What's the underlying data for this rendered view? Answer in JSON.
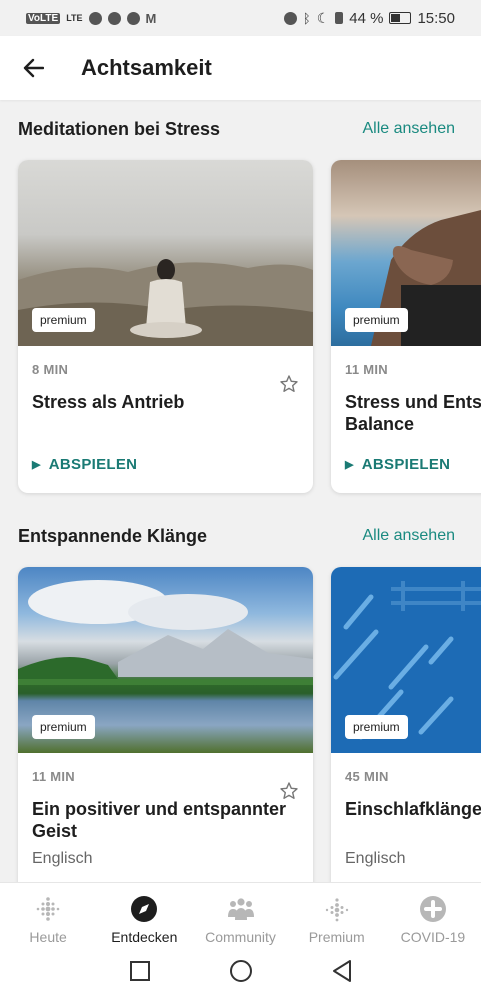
{
  "status_bar": {
    "left_icons": [
      "volte-icon",
      "lte-signal-icon",
      "eye-icon",
      "spotify-icon",
      "line-icon",
      "gmail-icon"
    ],
    "left_text": {
      "volte": "VoLTE",
      "lte": "LTE"
    },
    "battery_percent": "44 %",
    "battery_level": 0.44,
    "time": "15:50"
  },
  "app_bar": {
    "title": "Achtsamkeit"
  },
  "sections": [
    {
      "title": "Meditationen bei Stress",
      "see_all": "Alle ansehen",
      "cards": [
        {
          "badge": "premium",
          "duration": "8 MIN",
          "title": "Stress als Antrieb",
          "action": "ABSPIELEN"
        },
        {
          "badge": "premium",
          "duration": "11 MIN",
          "title": "Stress und Entspannung in Balance",
          "action": "ABSPIELEN"
        }
      ]
    },
    {
      "title": "Entspannende Klänge",
      "see_all": "Alle ansehen",
      "cards": [
        {
          "badge": "premium",
          "duration": "11 MIN",
          "title": "Ein positiver und entspannter Geist",
          "subtitle": "Englisch"
        },
        {
          "badge": "premium",
          "duration": "45 MIN",
          "title": "Einschlafklänge und",
          "subtitle": "Englisch"
        }
      ]
    }
  ],
  "bottom_nav": [
    {
      "label": "Heute",
      "icon": "dots-icon",
      "active": false
    },
    {
      "label": "Entdecken",
      "icon": "compass-icon",
      "active": true
    },
    {
      "label": "Community",
      "icon": "community-icon",
      "active": false
    },
    {
      "label": "Premium",
      "icon": "dots-icon",
      "active": false
    },
    {
      "label": "COVID-19",
      "icon": "plus-circle-icon",
      "active": false
    }
  ],
  "colors": {
    "accent": "#1a8a80",
    "play": "#1a7a74",
    "background": "#f1f1f1"
  }
}
